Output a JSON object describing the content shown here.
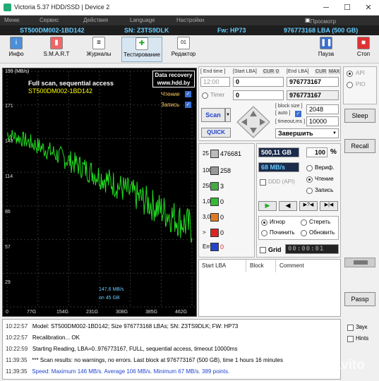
{
  "window": {
    "title": "Victoria 5.37 HDD/SSD | Device 2"
  },
  "menu": [
    "Меню",
    "Сервис",
    "Действия",
    "Language",
    "Настройки",
    "Просмотр буфера"
  ],
  "device": {
    "model": "ST500DM002-1BD142",
    "sn": "SN: Z3TS9DLK",
    "fw": "Fw: HP73",
    "lba": "976773168 LBA (500 GB)"
  },
  "toolbar": {
    "info": "Инфо",
    "smart": "S.M.A.R.T",
    "logs": "Журналы",
    "test": "Тестирование",
    "editor": "Редактор",
    "pause": "Пауза",
    "stop": "Стоп"
  },
  "graph": {
    "yunit": "199 (MB/s)",
    "title": "Full scan, sequential access",
    "model": "ST500DM002-1BD142",
    "ad1": "Data recovery",
    "ad2": "www.hdd.by",
    "read_label": "Чтение",
    "write_label": "Запись",
    "speed_info": "147,6 MB/s",
    "speed_pos": "on 45 GB",
    "yticks": [
      "171",
      "143",
      "114",
      "86",
      "57",
      "29"
    ],
    "xticks": [
      "0",
      "77G",
      "154G",
      "231G",
      "308G",
      "385G",
      "462G"
    ]
  },
  "lba": {
    "end_time_label": "[ End time ]",
    "start_lba_label": "[Start LBA]",
    "cur_label": "CUR",
    "zero_label": "0",
    "end_lba_label": "[End LBA]",
    "max_label": "MAX",
    "end_time_value": "12:00",
    "start_lba_value": "0",
    "end_lba_value": "976773167",
    "end_lba_value2": "976773167",
    "timer_label": "Timer",
    "timer_value": "0",
    "block_size_label": "[ block size ]",
    "auto_label": "[ auto ]",
    "block_size_value": "2048",
    "timeout_label": "[ timeout,ms ]",
    "timeout_value": "10000",
    "finish_label": "Завершить"
  },
  "scan": {
    "scan_label": "Scan",
    "quick_label": "QUICK"
  },
  "counters": [
    {
      "ms": "25",
      "value": "476681",
      "color": "#bbbbbb"
    },
    {
      "ms": "100",
      "value": "258",
      "color": "#999999"
    },
    {
      "ms": "250",
      "value": "3",
      "color": "#44aa44"
    },
    {
      "ms": "1,0s",
      "value": "0",
      "color": "#33bb33"
    },
    {
      "ms": "3,0s",
      "value": "0",
      "color": "#e07a20"
    },
    {
      "ms": ">",
      "value": "0",
      "color": "#dd2222"
    },
    {
      "ms": "Err",
      "value": "0",
      "color": "#2244cc"
    }
  ],
  "progress": {
    "done": "500,11 GB",
    "percent": "100",
    "percent_sign": "%",
    "speed": "68 MB/s",
    "timer": "00:00:01"
  },
  "options": {
    "verify": "Вериф.",
    "read": "Чтение",
    "write": "Запись",
    "ddd": "DDD (API)",
    "ignore": "Игнор",
    "erase": "Стереть",
    "refresh": "Починить",
    "update": "Обновить",
    "grid": "Grid"
  },
  "api": {
    "api": "API",
    "pio": "PIO"
  },
  "side": {
    "sleep": "Sleep",
    "recall": "Recall",
    "passp": "Passp"
  },
  "table": {
    "col1": "Start LBA",
    "col2": "Block",
    "col3": "Comment"
  },
  "log": [
    {
      "time": "10:22:57",
      "text": "Model: ST500DM002-1BD142; Size 976773168 LBAs; SN: Z3TS9DLK; FW: HP73",
      "color": "#000000"
    },
    {
      "time": "10:22:57",
      "text": "Recalibration... OK",
      "color": "#000000"
    },
    {
      "time": "10:22:59",
      "text": "Starting Reading, LBA=0..976773167, FULL, sequential access, timeout 10000ms",
      "color": "#000000"
    },
    {
      "time": "11:39:35",
      "text": "*** Scan results: no warnings, no errors. Last block at 976773167 (500 GB), time 1 hours 16 minutes",
      "color": "#000000"
    },
    {
      "time": "11:39:35",
      "text": "Speed: Maximum 146 MB/s. Average 106 MB/s. Minimum 67 MB/s. 389 points.",
      "color": "#2244cc"
    }
  ],
  "log_side": {
    "sound": "Звук",
    "hints": "Hints"
  },
  "watermark": "Avito",
  "colors": {
    "graph_line": "#22dd22",
    "accent": "#3a6fd0"
  }
}
